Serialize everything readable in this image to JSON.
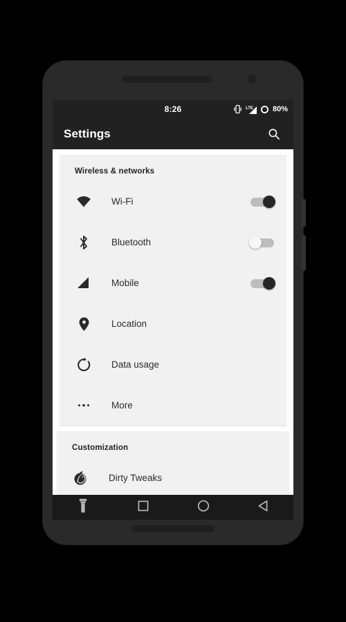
{
  "device": {
    "frame_color": "#2a2a2a",
    "screen_bg": "#f4f4f4"
  },
  "status_bar": {
    "time": "8:26",
    "battery_percent": "80%",
    "network_type": "LTE",
    "icons": [
      "vibrate-icon",
      "lte-signal-icon",
      "battery-circle-icon"
    ],
    "background": "#212121"
  },
  "app_bar": {
    "title": "Settings",
    "search_icon": "search-icon",
    "background": "#212121"
  },
  "sections": [
    {
      "title": "Wireless & networks",
      "rows": [
        {
          "label": "Wi-Fi",
          "icon": "wifi-icon",
          "toggle": "on"
        },
        {
          "label": "Bluetooth",
          "icon": "bluetooth-icon",
          "toggle": "off"
        },
        {
          "label": "Mobile",
          "icon": "signal-icon",
          "toggle": "on"
        },
        {
          "label": "Location",
          "icon": "location-pin-icon",
          "toggle": null
        },
        {
          "label": "Data usage",
          "icon": "data-usage-icon",
          "toggle": null
        },
        {
          "label": "More",
          "icon": "more-dots-icon",
          "toggle": null
        }
      ]
    },
    {
      "title": "Customization",
      "rows": [
        {
          "label": "Dirty Tweaks",
          "icon": "unicorn-icon",
          "toggle": null
        }
      ]
    }
  ],
  "nav_bar": {
    "buttons": [
      {
        "name": "flashlight-button",
        "icon": "flashlight-icon"
      },
      {
        "name": "recents-button",
        "icon": "square-icon"
      },
      {
        "name": "home-button",
        "icon": "circle-icon"
      },
      {
        "name": "back-button",
        "icon": "triangle-back-icon"
      }
    ],
    "background": "#1a1a1a"
  },
  "colors": {
    "accent_dark": "#262626",
    "card": "#f1f1f1",
    "text_primary": "#2b2b2b",
    "bar": "#212121"
  }
}
